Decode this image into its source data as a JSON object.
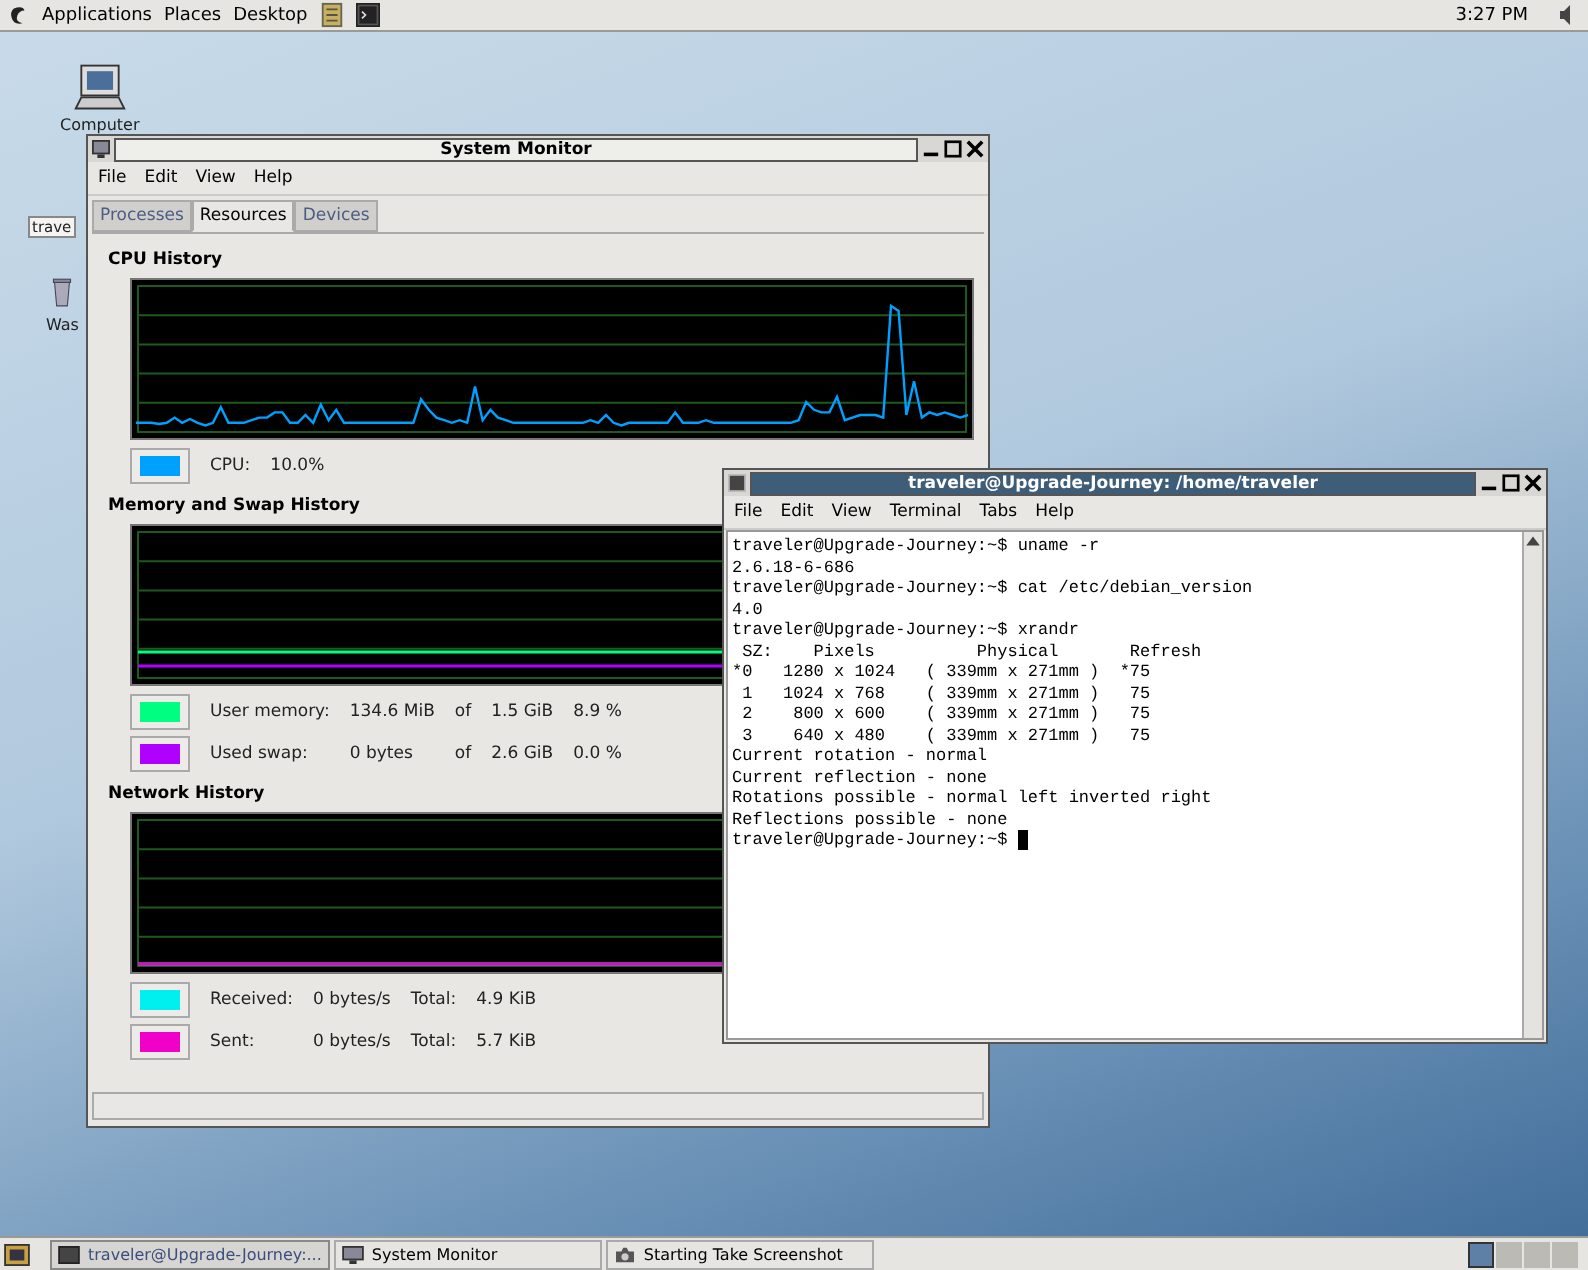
{
  "top_panel": {
    "menus": [
      "Applications",
      "Places",
      "Desktop"
    ],
    "clock": "3:27 PM"
  },
  "desktop_icons": [
    {
      "kind": "computer",
      "label": "Computer"
    },
    {
      "kind": "home",
      "label": "trave"
    },
    {
      "kind": "trash",
      "label": "Was"
    }
  ],
  "system_monitor": {
    "title": "System Monitor",
    "menus": [
      "File",
      "Edit",
      "View",
      "Help"
    ],
    "tabs": [
      {
        "label": "Processes",
        "selected": false
      },
      {
        "label": "Resources",
        "selected": true
      },
      {
        "label": "Devices",
        "selected": false
      }
    ],
    "sections": [
      {
        "kind": "cpu",
        "title": "CPU History",
        "legend": [
          {
            "color": "#00a0ff",
            "cells": [
              "CPU:",
              "10.0%"
            ]
          }
        ]
      },
      {
        "kind": "memory",
        "title": "Memory and Swap History",
        "legend": [
          {
            "color": "#00ff80",
            "cells": [
              "User memory:",
              "134.6 MiB",
              "of",
              "1.5 GiB",
              "8.9 %"
            ]
          },
          {
            "color": "#b000ff",
            "cells": [
              "Used swap:",
              "0 bytes",
              "of",
              "2.6 GiB",
              "0.0 %"
            ]
          }
        ]
      },
      {
        "kind": "network",
        "title": "Network History",
        "legend": [
          {
            "color": "#00f0f0",
            "cells": [
              "Received:",
              "0 bytes/s",
              "Total:",
              "4.9 KiB"
            ]
          },
          {
            "color": "#f000c8",
            "cells": [
              "Sent:",
              "0 bytes/s",
              "Total:",
              "5.7 KiB"
            ]
          }
        ]
      }
    ]
  },
  "terminal": {
    "title": "traveler@Upgrade-Journey: /home/traveler",
    "menus": [
      "File",
      "Edit",
      "View",
      "Terminal",
      "Tabs",
      "Help"
    ],
    "lines": [
      "traveler@Upgrade-Journey:~$ uname -r",
      "2.6.18-6-686",
      "traveler@Upgrade-Journey:~$ cat /etc/debian_version",
      "4.0",
      "traveler@Upgrade-Journey:~$ xrandr",
      " SZ:    Pixels          Physical       Refresh",
      "*0   1280 x 1024   ( 339mm x 271mm )  *75",
      " 1   1024 x 768    ( 339mm x 271mm )   75",
      " 2    800 x 600    ( 339mm x 271mm )   75",
      " 3    640 x 480    ( 339mm x 271mm )   75",
      "Current rotation - normal",
      "Current reflection - none",
      "Rotations possible - normal left inverted right",
      "Reflections possible - none"
    ],
    "prompt": "traveler@Upgrade-Journey:~$ "
  },
  "taskbar": {
    "tasks": [
      {
        "kind": "terminal",
        "label": "traveler@Upgrade-Journey:...",
        "selected": true
      },
      {
        "kind": "monitor",
        "label": "System Monitor",
        "selected": false
      },
      {
        "kind": "camera",
        "label": "Starting Take Screenshot",
        "selected": false
      }
    ],
    "workspaces": [
      {
        "selected": true
      },
      {
        "selected": false
      },
      {
        "selected": false
      },
      {
        "selected": false
      }
    ]
  }
}
